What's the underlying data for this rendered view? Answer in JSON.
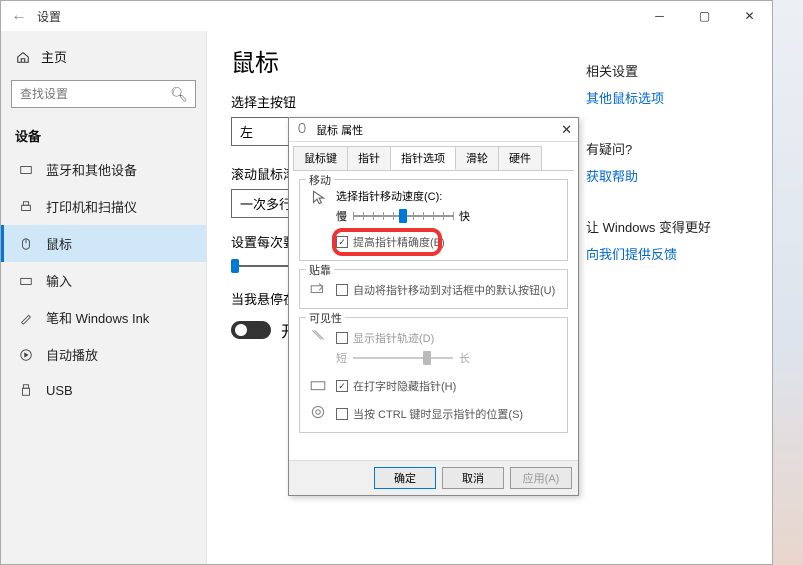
{
  "titlebar": {
    "title": "设置"
  },
  "sidebar": {
    "home": "主页",
    "search_placeholder": "查找设置",
    "section": "设备",
    "items": [
      {
        "label": "蓝牙和其他设备"
      },
      {
        "label": "打印机和扫描仪"
      },
      {
        "label": "鼠标"
      },
      {
        "label": "输入"
      },
      {
        "label": "笔和 Windows Ink"
      },
      {
        "label": "自动播放"
      },
      {
        "label": "USB"
      }
    ]
  },
  "main": {
    "title": "鼠标",
    "primary_button_label": "选择主按钮",
    "primary_button_value": "左",
    "scroll_label": "滚动鼠标滚轮即可滚动",
    "scroll_value": "一次多行",
    "lines_label": "设置每次要滚动的行数",
    "hover_label": "当我悬停在非活动窗口上方时对其进行滚动",
    "toggle_state": "开"
  },
  "rightcol": {
    "related_hdr": "相关设置",
    "related_link": "其他鼠标选项",
    "help_hdr": "有疑问?",
    "help_link": "获取帮助",
    "better_hdr": "让 Windows 变得更好",
    "feedback_link": "向我们提供反馈"
  },
  "dialog": {
    "title": "鼠标 属性",
    "tabs": [
      "鼠标键",
      "指针",
      "指针选项",
      "滑轮",
      "硬件"
    ],
    "active_tab": 2,
    "group_motion": {
      "label": "移动",
      "subtitle": "选择指针移动速度(C):",
      "slow": "慢",
      "fast": "快",
      "precision": "提高指针精确度(E)"
    },
    "group_snap": {
      "label": "贴靠",
      "text": "自动将指针移动到对话框中的默认按钮(U)"
    },
    "group_visibility": {
      "label": "可见性",
      "trails": "显示指针轨迹(D)",
      "short": "短",
      "long": "长",
      "hide_typing": "在打字时隐藏指针(H)",
      "ctrl_show": "当按 CTRL 键时显示指针的位置(S)"
    },
    "buttons": {
      "ok": "确定",
      "cancel": "取消",
      "apply": "应用(A)"
    }
  }
}
